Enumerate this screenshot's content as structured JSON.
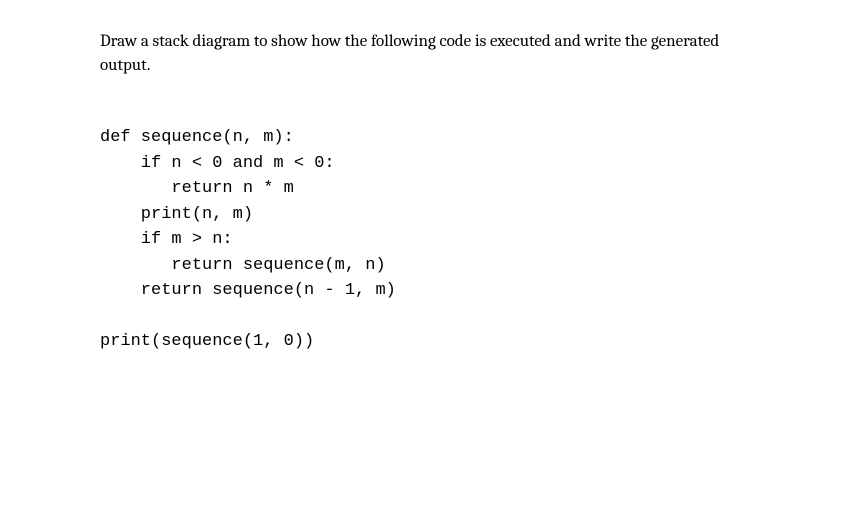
{
  "question": {
    "text": "Draw a stack diagram to show how the following code is executed and write the generated output."
  },
  "code": {
    "line1": "def sequence(n, m):",
    "line2": "    if n < 0 and m < 0:",
    "line3": "       return n * m",
    "line4": "    print(n, m)",
    "line5": "    if m > n:",
    "line6": "       return sequence(m, n)",
    "line7": "    return sequence(n - 1, m)",
    "line8": "",
    "line9": "print(sequence(1, 0))"
  }
}
